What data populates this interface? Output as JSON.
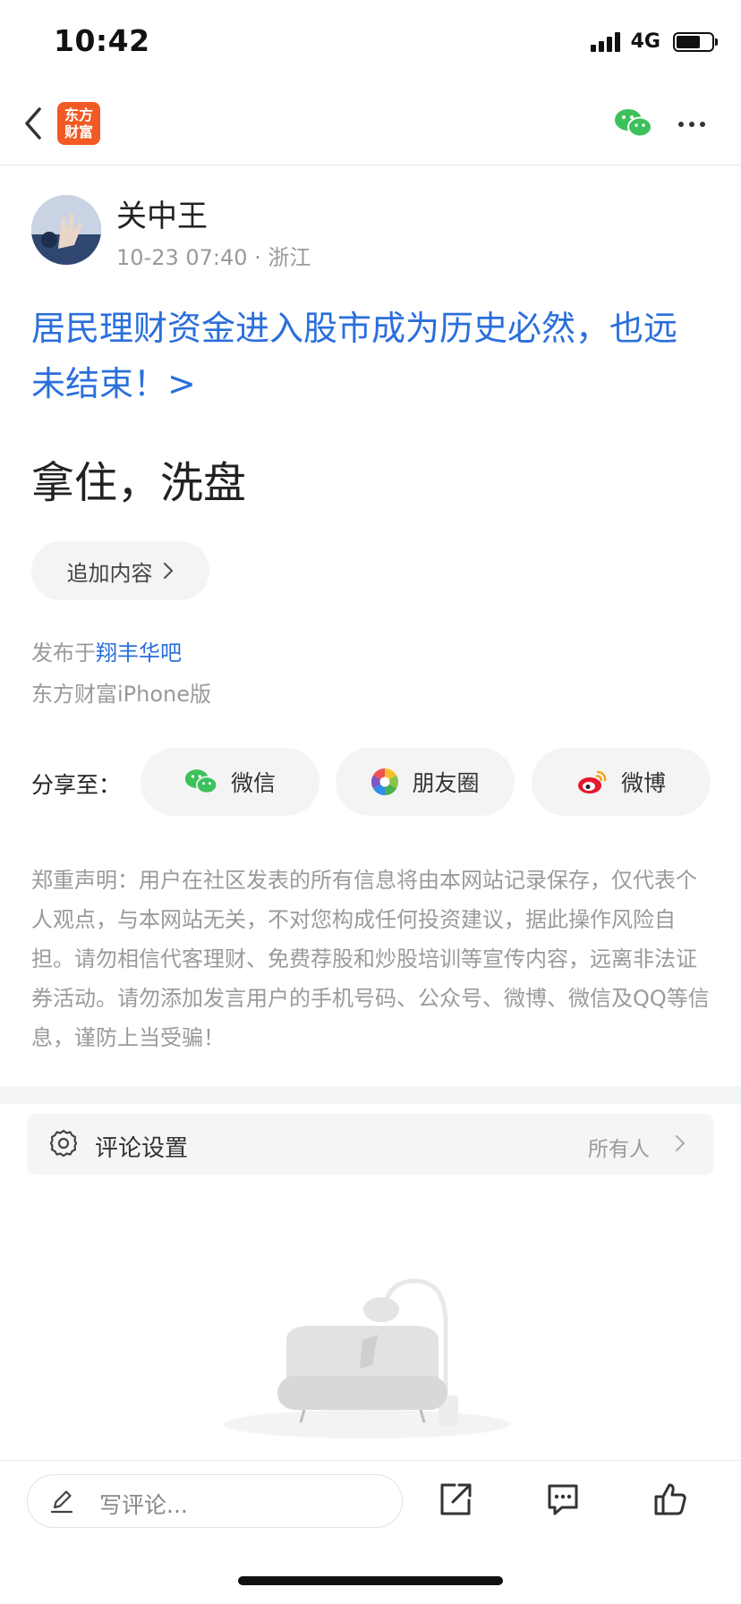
{
  "status_bar": {
    "time": "10:42",
    "network": "4G"
  },
  "nav": {
    "logo_line1": "东方",
    "logo_line2": "财富"
  },
  "author": {
    "name": "关中王",
    "meta": "10-23 07:40 · 浙江"
  },
  "post": {
    "title": "居民理财资金进入股市成为历史必然，也远未结束！>",
    "body": "拿住，洗盘",
    "append_label": "追加内容",
    "published_prefix": "发布于",
    "published_bar": "翔丰华吧",
    "platform": "东方财富iPhone版"
  },
  "share": {
    "label": "分享至：",
    "wechat": "微信",
    "moments": "朋友圈",
    "weibo": "微博"
  },
  "disclaimer": "郑重声明：用户在社区发表的所有信息将由本网站记录保存，仅代表个人观点，与本网站无关，不对您构成任何投资建议，据此操作风险自担。请勿相信代客理财、免费荐股和炒股培训等宣传内容，远离非法证券活动。请勿添加发言用户的手机号码、公众号、微博、微信及QQ等信息，谨防上当受骗！",
  "comment_settings": {
    "label": "评论设置",
    "value": "所有人"
  },
  "bottom_bar": {
    "comment_placeholder": "写评论..."
  },
  "colors": {
    "link": "#2a6fdb",
    "brand": "#f15a24",
    "wechat": "#3cc15b"
  }
}
